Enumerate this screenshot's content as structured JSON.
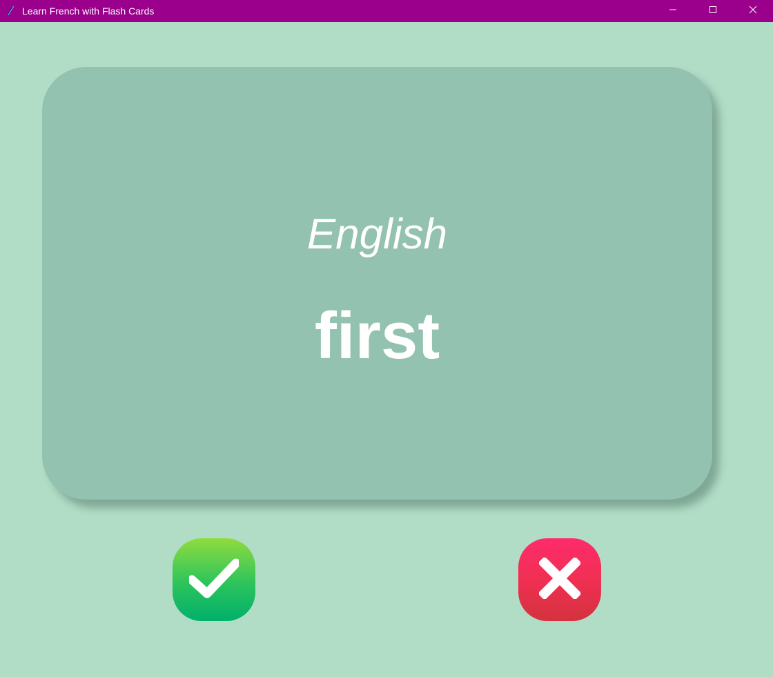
{
  "window": {
    "title": "Learn French with Flash Cards",
    "icon": "feather-icon",
    "controls": [
      "minimize-icon",
      "maximize-icon",
      "close-icon"
    ],
    "titlebar_color": "#9a008c"
  },
  "background_color": "#b1ddc6",
  "card": {
    "title": "English",
    "word": "first",
    "color": "#93c2b0",
    "text_color": "#ffffff"
  },
  "buttons": {
    "right": {
      "icon": "checkmark-icon",
      "color": "#2cc35c"
    },
    "wrong": {
      "icon": "cross-icon",
      "color": "#ee3050"
    }
  }
}
